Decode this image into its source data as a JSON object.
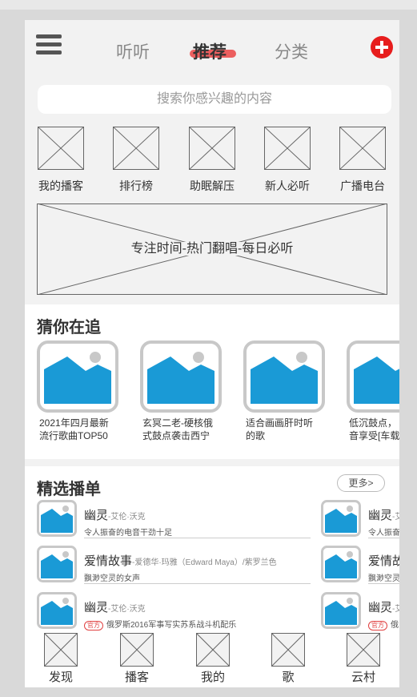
{
  "header": {
    "menu_icon": "hamburger-menu-icon",
    "tabs": [
      {
        "label": "听听"
      },
      {
        "label": "推荐",
        "active": true
      },
      {
        "label": "分类"
      }
    ],
    "add_icon": "plus-circle-icon",
    "accent_color": "#e71d1d",
    "underline_color": "#ec5f5f"
  },
  "search": {
    "placeholder": "搜索你感兴趣的内容"
  },
  "entries": [
    {
      "label": "我的播客"
    },
    {
      "label": "排行榜"
    },
    {
      "label": "助眠解压"
    },
    {
      "label": "新人必听"
    },
    {
      "label": "广播电台"
    }
  ],
  "banner": {
    "text": "专注时间-热门翻唱-每日必听"
  },
  "guess": {
    "title": "猜你在追",
    "cards": [
      {
        "line1": "2021年四月最新",
        "line2": "流行歌曲TOP50"
      },
      {
        "line1": "玄冥二老-硬核俄",
        "line2": "式鼓点袭击西宁"
      },
      {
        "line1": "适合画画肝时听",
        "line2": "的歌"
      },
      {
        "line1": "低沉鼓点，",
        "line2": "音享受[车载"
      }
    ]
  },
  "playlists": {
    "title": "精选播单",
    "more_label": "更多>",
    "left_rows": [
      {
        "title": "幽灵",
        "artist": "-艾伦·沃克",
        "subtitle": "令人振奋的电音干劲十足",
        "tag": ""
      },
      {
        "title": "爱情故事",
        "artist": "-爱德华·玛雅（Edward Maya）/紫罗兰色",
        "subtitle": "飘渺空灵的女声",
        "tag": ""
      },
      {
        "title": "幽灵",
        "artist": "-艾伦·沃克",
        "subtitle": "俄罗斯2016军事写实苏系战斗机配乐",
        "tag": "官方"
      }
    ],
    "right_rows": [
      {
        "title": "幽灵",
        "artist": "-艾",
        "subtitle": "令人振奋",
        "tag": ""
      },
      {
        "title": "爱情故",
        "artist": "",
        "subtitle": "飘渺空灵",
        "tag": ""
      },
      {
        "title": "幽灵",
        "artist": "-艾",
        "subtitle": "俄罗",
        "tag": "官方"
      }
    ]
  },
  "bottom_nav": [
    {
      "label": "发现"
    },
    {
      "label": "播客"
    },
    {
      "label": "我的"
    },
    {
      "label": "歌"
    },
    {
      "label": "云村"
    }
  ],
  "colors": {
    "image_blue": "#1a9ad6",
    "image_frame": "#c8c8c8",
    "placeholder_stroke": "#666666"
  }
}
